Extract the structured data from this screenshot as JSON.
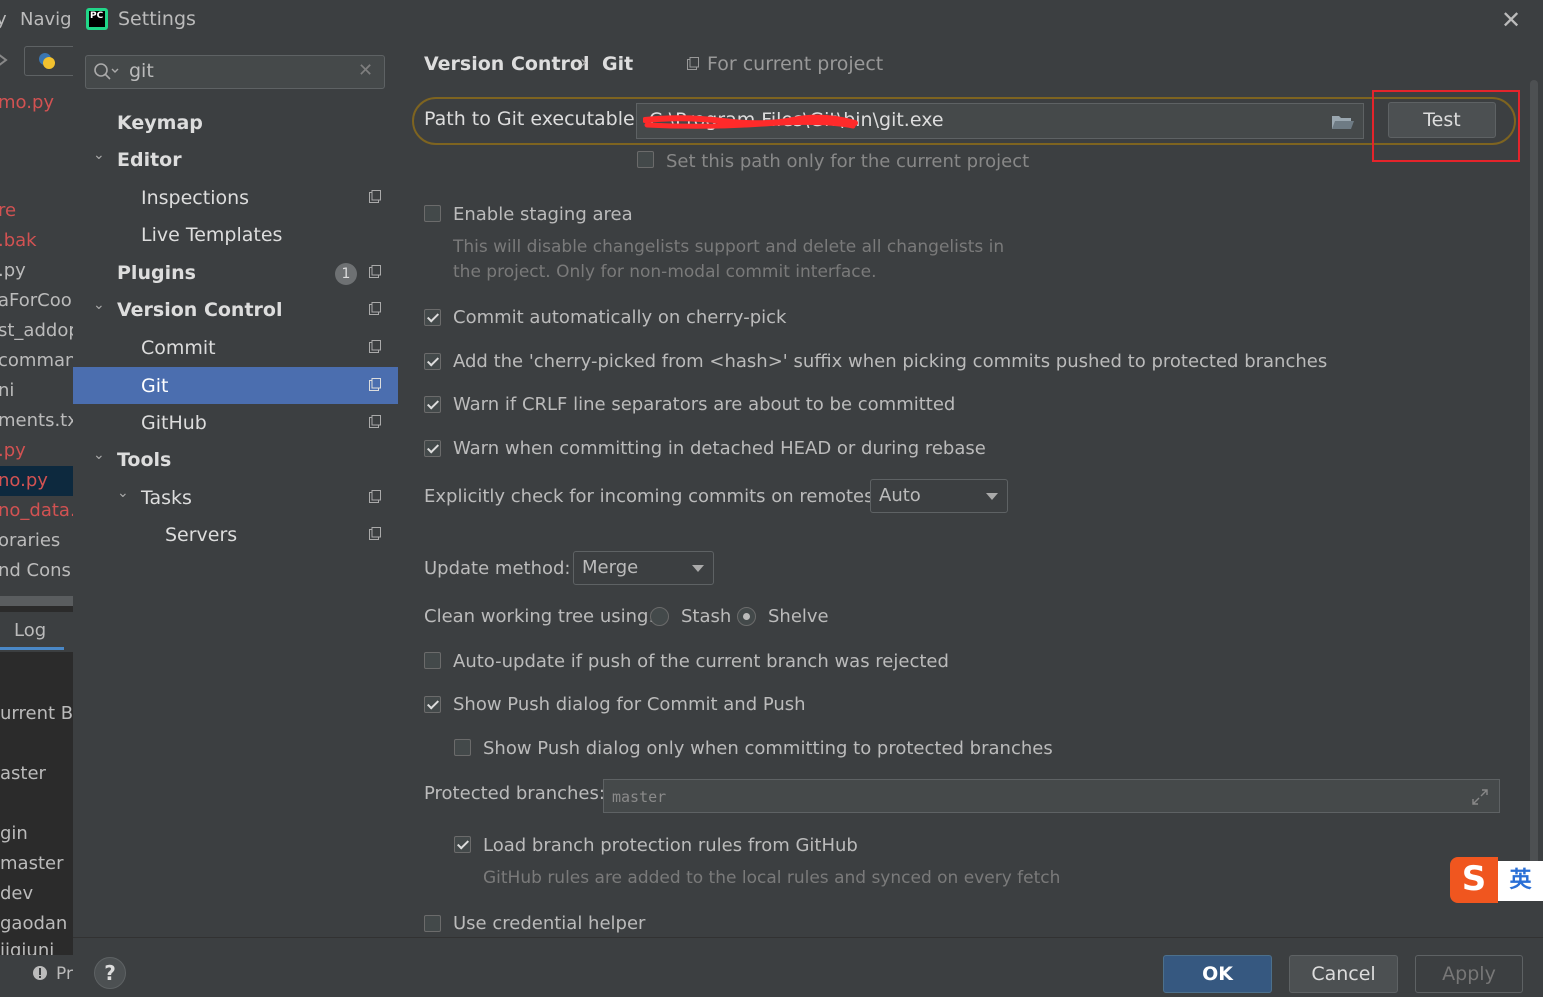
{
  "background_ide": {
    "menu": [
      "y",
      "Navig"
    ],
    "files": [
      {
        "text": "mo.py",
        "color": "red"
      },
      {
        "text": "re",
        "color": "red"
      },
      {
        "text": ".bak",
        "color": "red"
      },
      {
        "text": ".py",
        "color": "normal"
      },
      {
        "text": "aForCook",
        "color": "normal"
      },
      {
        "text": "st_addop",
        "color": "normal"
      },
      {
        "text": "comman",
        "color": "normal"
      },
      {
        "text": "ni",
        "color": "normal"
      },
      {
        "text": "ments.txt",
        "color": "normal"
      },
      {
        "text": ".py",
        "color": "red"
      },
      {
        "text": "no.py",
        "color": "red"
      },
      {
        "text": "no_data.t",
        "color": "red"
      },
      {
        "text": "oraries",
        "color": "normal"
      },
      {
        "text": "nd Cons",
        "color": "normal"
      }
    ],
    "log_tab": "Log",
    "branches": [
      "urrent Br",
      "aster",
      "gin",
      "master",
      "dev",
      "gaodan",
      "iiqiuni"
    ],
    "status_text": "Pr"
  },
  "dialog": {
    "title": "Settings",
    "search": {
      "value": "git"
    },
    "nav": [
      {
        "label": "Keymap",
        "bold": true
      },
      {
        "label": "Editor",
        "bold": true
      },
      {
        "label": "Inspections",
        "bold": false
      },
      {
        "label": "Live Templates",
        "bold": false
      },
      {
        "label": "Plugins",
        "bold": true,
        "badge": "1"
      },
      {
        "label": "Version Control",
        "bold": true
      },
      {
        "label": "Commit",
        "bold": false
      },
      {
        "label": "Git",
        "bold": false,
        "selected": true
      },
      {
        "label": "GitHub",
        "bold": false
      },
      {
        "label": "Tools",
        "bold": true
      },
      {
        "label": "Tasks",
        "bold": false
      },
      {
        "label": "Servers",
        "bold": false
      }
    ],
    "breadcrumb": {
      "parent": "Version Control",
      "separator": "›",
      "current": "Git",
      "scope": "For current project"
    },
    "git": {
      "path_label": "Path to Git executable:",
      "path_value": "C:\\Program Files\\Git\\bin\\git.exe",
      "path_visible_suffix": "\\git.exe",
      "test_button": "Test",
      "current_project_only": {
        "label": "Set this path only for the current project",
        "checked": false
      },
      "staging": {
        "label": "Enable staging area",
        "checked": false,
        "desc1": "This will disable changelists support and delete all changelists in",
        "desc2": "the project. Only for non-modal commit interface."
      },
      "cherry_pick_commit": {
        "label": "Commit automatically on cherry-pick",
        "checked": true
      },
      "cherry_pick_suffix": {
        "label": "Add the 'cherry-picked from <hash>' suffix when picking commits pushed to protected branches",
        "checked": true
      },
      "crlf_warn": {
        "label": "Warn if CRLF line separators are about to be committed",
        "checked": true
      },
      "detached_warn": {
        "label": "Warn when committing in detached HEAD or during rebase",
        "checked": true
      },
      "incoming_label": "Explicitly check for incoming commits on remotes:",
      "incoming_value": "Auto",
      "update_label": "Update method:",
      "update_value": "Merge",
      "clean_label": "Clean working tree using:",
      "clean_options": [
        "Stash",
        "Shelve"
      ],
      "clean_selected": "Shelve",
      "auto_update": {
        "label": "Auto-update if push of the current branch was rejected",
        "checked": false
      },
      "show_push": {
        "label": "Show Push dialog for Commit and Push",
        "checked": true
      },
      "show_push_protected": {
        "label": "Show Push dialog only when committing to protected branches",
        "checked": false
      },
      "protected_label": "Protected branches:",
      "protected_value": "master",
      "load_rules": {
        "label": "Load branch protection rules from GitHub",
        "checked": true,
        "desc": "GitHub rules are added to the local rules and synced on every fetch"
      },
      "credential_helper": {
        "label": "Use credential helper",
        "checked": false
      }
    },
    "buttons": {
      "help": "?",
      "ok": "OK",
      "cancel": "Cancel",
      "apply": "Apply"
    },
    "colors": {
      "accent": "#4b6eaf",
      "ok": "#365880",
      "highlight": "#e5242b",
      "ring": "#7e6420"
    }
  },
  "ime": {
    "logo": "S",
    "mode": "英"
  }
}
